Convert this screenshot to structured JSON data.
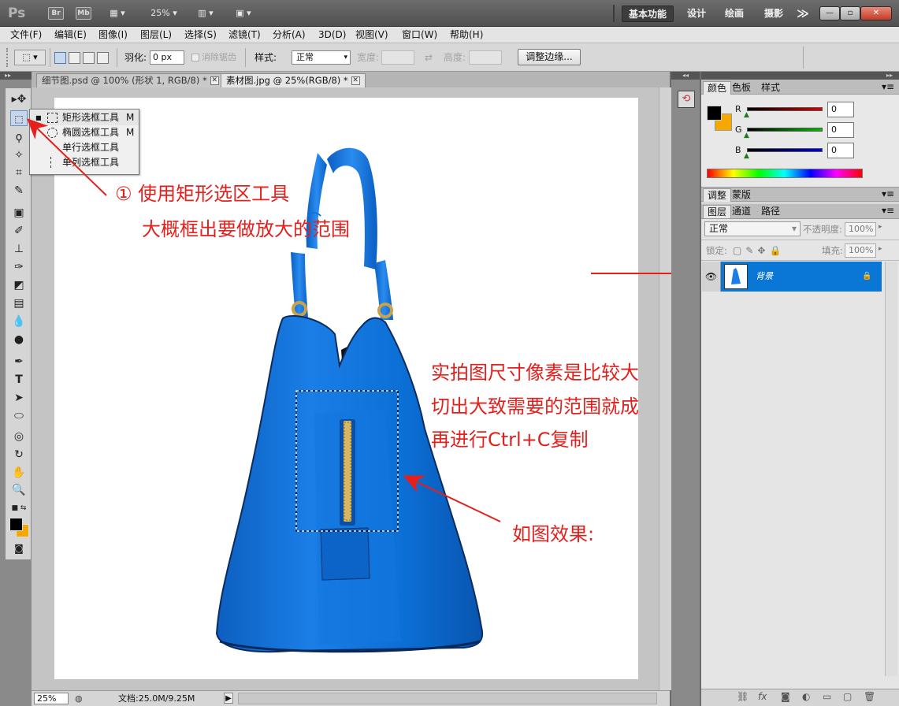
{
  "titlebar": {
    "logo": "Ps",
    "bridge_chip": "Br",
    "minibridge_chip": "Mb",
    "zoom": "25%",
    "workspaces": [
      "基本功能",
      "设计",
      "绘画",
      "摄影"
    ],
    "more": "≫",
    "win_min": "—",
    "win_max": "▫",
    "win_close": "✕"
  },
  "menu": [
    "文件(F)",
    "编辑(E)",
    "图像(I)",
    "图层(L)",
    "选择(S)",
    "滤镜(T)",
    "分析(A)",
    "3D(D)",
    "视图(V)",
    "窗口(W)",
    "帮助(H)"
  ],
  "options": {
    "feather_label": "羽化:",
    "feather_value": "0 px",
    "antialias_label": "消除锯齿",
    "style_label": "样式:",
    "style_value": "正常",
    "width_label": "宽度:",
    "height_label": "高度:",
    "refine_button": "调整边缘..."
  },
  "tabs": [
    {
      "title": "细节图.psd @ 100% (形状 1, RGB/8) *"
    },
    {
      "title": "素材图.jpg @ 25%(RGB/8) *"
    }
  ],
  "flyout": [
    {
      "label": "矩形选框工具",
      "key": "M",
      "active": true
    },
    {
      "label": "椭圆选框工具",
      "key": "M"
    },
    {
      "label": "单行选框工具",
      "key": ""
    },
    {
      "label": "单列选框工具",
      "key": ""
    }
  ],
  "annotations": {
    "step1_line1": "① 使用矩形选区工具",
    "step1_line2": "大概框出要做放大的范围",
    "note_line1": "实拍图尺寸像素是比较大",
    "note_line2": "切出大致需要的范围就成",
    "note_line3": "再进行Ctrl+C复制",
    "effect": "如图效果:"
  },
  "status": {
    "zoom": "25%",
    "doc_info": "文档:25.0M/9.25M"
  },
  "color_panel": {
    "tabs": [
      "颜色",
      "色板",
      "样式"
    ],
    "channels": [
      {
        "label": "R",
        "value": "0"
      },
      {
        "label": "G",
        "value": "0"
      },
      {
        "label": "B",
        "value": "0"
      }
    ],
    "foreground": "#000000",
    "background": "#f5a800"
  },
  "adjust_panel": {
    "tabs": [
      "调整",
      "蒙版"
    ]
  },
  "layers_panel": {
    "tabs": [
      "图层",
      "通道",
      "路径"
    ],
    "blend_mode": "正常",
    "opacity_label": "不透明度:",
    "opacity_value": "100%",
    "lock_label": "锁定:",
    "fill_label": "填充:",
    "fill_value": "100%",
    "layer_name": "背景"
  },
  "colors": {
    "accent_blue": "#0a76d6",
    "annotation_red": "#e3201c"
  }
}
